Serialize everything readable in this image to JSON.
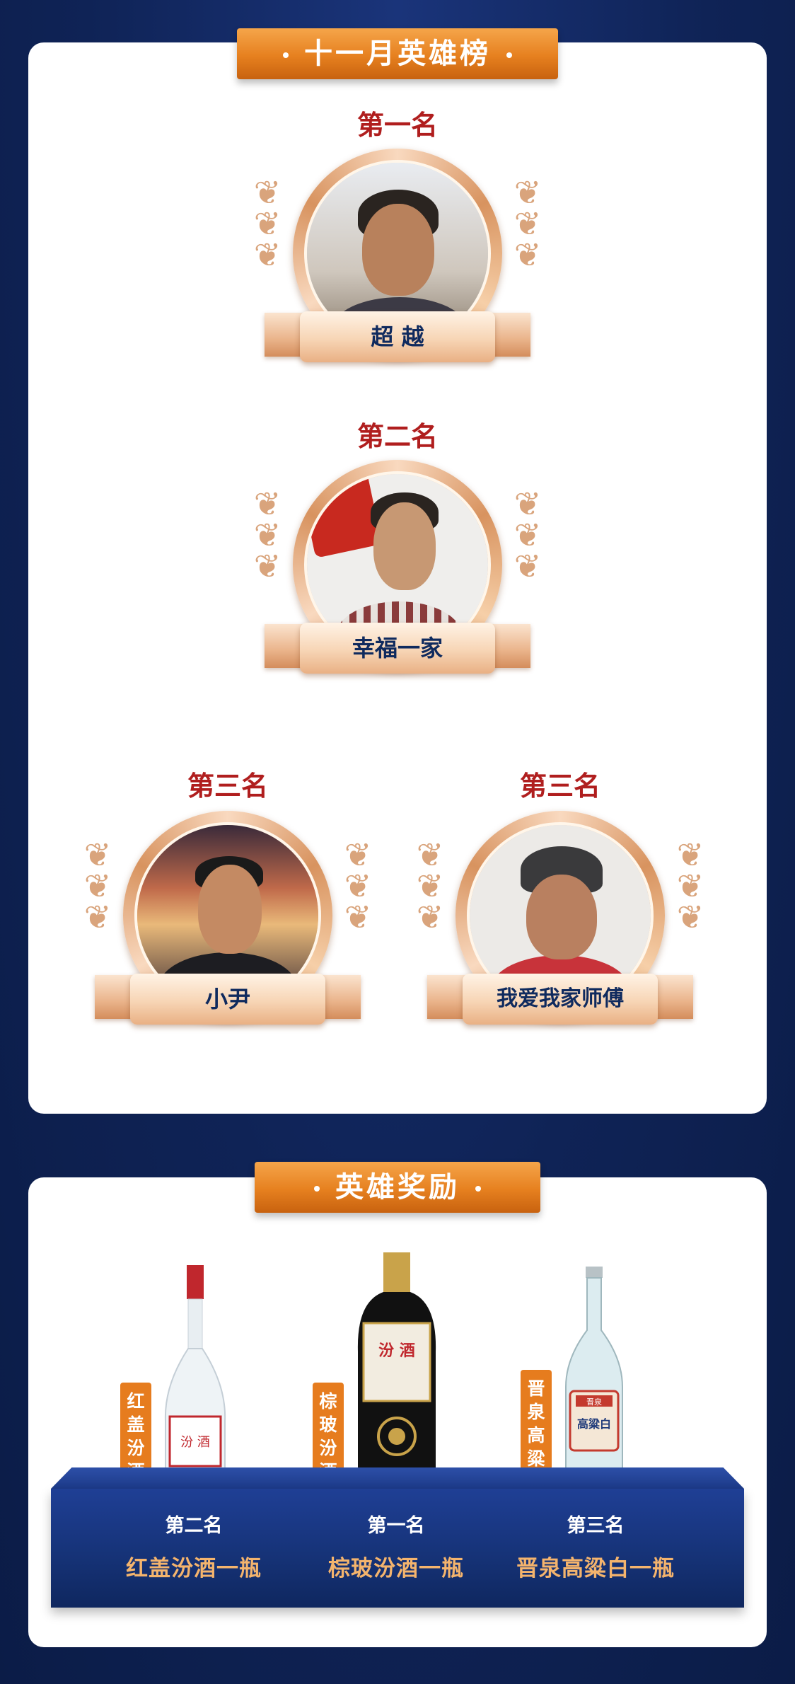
{
  "heroes": {
    "title": "十一月英雄榜",
    "entries": [
      {
        "rank": "第一名",
        "name": "超 越"
      },
      {
        "rank": "第二名",
        "name": "幸福一家"
      },
      {
        "rank": "第三名",
        "name": "小尹"
      },
      {
        "rank": "第三名",
        "name": "我爱我家师傅"
      }
    ]
  },
  "rewards": {
    "title": "英雄奖励",
    "prizes": [
      {
        "rank": "第二名",
        "prize": "红盖汾酒一瓶",
        "tag": "红盖汾酒"
      },
      {
        "rank": "第一名",
        "prize": "棕玻汾酒一瓶",
        "tag": "棕玻汾酒"
      },
      {
        "rank": "第三名",
        "prize": "晋泉高粱白一瓶",
        "tag": "晋泉高粱白"
      }
    ],
    "bottle_labels": {
      "red_cap": "汾 酒",
      "brown_glass": "汾 酒",
      "jinquan_brand": "晋泉",
      "jinquan_main": "高粱白"
    }
  },
  "colors": {
    "background": "#0f2356",
    "banner": "#e6801f",
    "rank_text": "#b01e1e",
    "name_text": "#0f2a5e",
    "prize_text": "#f4b46d"
  },
  "icons": [
    "laurel-icon"
  ]
}
